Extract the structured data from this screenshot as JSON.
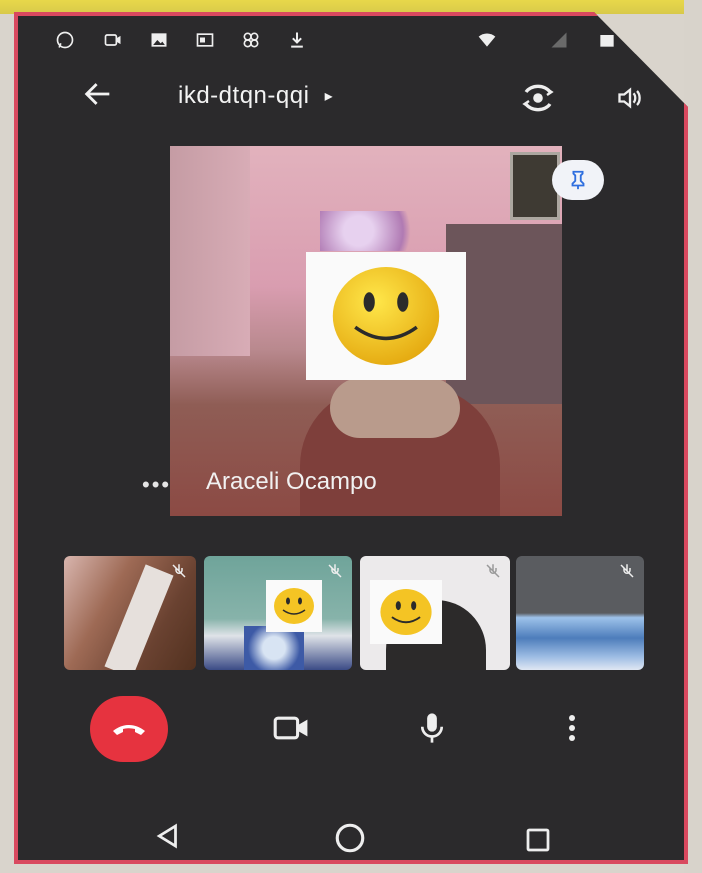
{
  "meeting": {
    "code": "ikd-dtqn-qqi",
    "code_chevron": "▸"
  },
  "main_speaker": {
    "name": "Araceli Ocampo",
    "more_label": "•••"
  },
  "thumbnails": [
    {
      "id": "participant-1"
    },
    {
      "id": "participant-2"
    },
    {
      "id": "participant-3"
    },
    {
      "id": "participant-4"
    }
  ],
  "colors": {
    "end_call": "#e6333f",
    "frame_border": "#d9495f",
    "background": "#2b2a2c"
  },
  "icons": {
    "status": [
      "whatsapp-icon",
      "video-icon",
      "image-icon",
      "cast-icon",
      "flower-icon",
      "download-icon",
      "wifi-icon",
      "signal-icon",
      "battery-icon"
    ],
    "app_bar": [
      "back-arrow-icon",
      "switch-camera-icon",
      "speaker-icon"
    ],
    "controls": [
      "hangup-icon",
      "camera-icon",
      "microphone-icon",
      "more-vertical-icon"
    ],
    "nav": [
      "back-triangle-icon",
      "home-circle-icon",
      "recents-square-icon"
    ]
  }
}
